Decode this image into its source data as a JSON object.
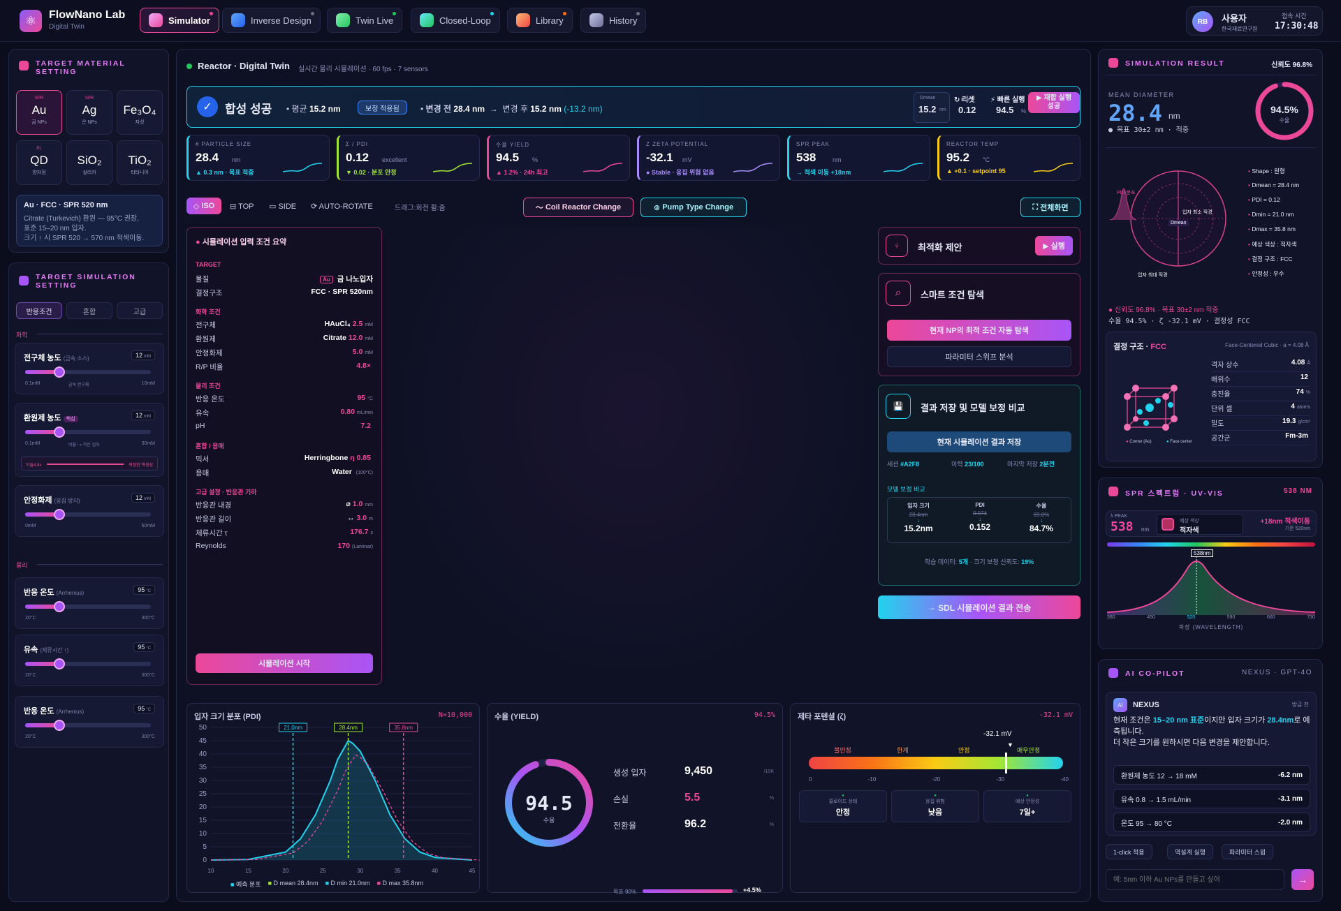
{
  "app": {
    "name": "FlowNano Lab",
    "subtitle": "Digital Twin"
  },
  "nav": [
    {
      "label": "Simulator",
      "color": "#ec4899"
    },
    {
      "label": "Inverse Design",
      "color": "#3b82f6"
    },
    {
      "label": "Twin Live",
      "color": "#22c55e"
    },
    {
      "label": "Closed-Loop",
      "color": "#22d3ee"
    },
    {
      "label": "Library",
      "color": "#f97316"
    },
    {
      "label": "History",
      "color": "#8b8fbf"
    }
  ],
  "user": {
    "initials": "RB",
    "name": "사용자",
    "org": "한국재료연구원",
    "time_label": "접속 시간",
    "time": "17:30:48"
  },
  "material": {
    "title": "TARGET MATERIAL SETTING",
    "items": [
      {
        "tag": "SPR",
        "sym": "Au",
        "name": "금 NPs"
      },
      {
        "tag": "SPR",
        "sym": "Ag",
        "name": "은 NPs"
      },
      {
        "tag": "",
        "sym": "Fe₃O₄",
        "name": "자성"
      },
      {
        "tag": "PL",
        "sym": "QD",
        "name": "양자점"
      },
      {
        "tag": "",
        "sym": "SiO₂",
        "name": "실리카"
      },
      {
        "tag": "",
        "sym": "TiO₂",
        "name": "티타니아"
      }
    ],
    "info_title": "Au · FCC · SPR 520 nm",
    "info_l1": "Citrate (Turkevich) 환원 — 95°C 권장,",
    "info_l2": "표준 15–20 nm 입자.",
    "info_l3": "크기 ↑ 시 SPR 520 → 570 nm 적색이동."
  },
  "simset": {
    "title": "TARGET SIMULATION SETTING",
    "tabs": [
      "반응조건",
      "혼합",
      "고급"
    ],
    "sec1": "화학",
    "sec2": "물리",
    "sliders": [
      {
        "label": "전구체 농도",
        "hint": "(금속 소스)",
        "val": "12",
        "unit": "mM",
        "min": "0.1mM",
        "mid": "금속 전구체",
        "max": "10mM",
        "frac": 0.27
      },
      {
        "label": "환원제 농도",
        "hint": "핵심",
        "val": "12",
        "unit": "mM",
        "min": "0.1mM",
        "mid": "비율↑ = 작은 입자",
        "max": "30mM",
        "frac": 0.27,
        "sub": "이들4.8x",
        "sub2": "적정한 핵생성"
      },
      {
        "label": "안정화제",
        "hint": "(응집 방지)",
        "val": "12",
        "unit": "mM",
        "min": "0mM",
        "mid": "",
        "max": "50mM",
        "frac": 0.27
      },
      {
        "label": "반응 온도",
        "hint": "(Arrhenius)",
        "val": "95",
        "unit": "°C",
        "min": "20°C",
        "mid": "",
        "max": "300°C",
        "frac": 0.27
      },
      {
        "label": "유속",
        "hint": "(체류시간 ↑)",
        "val": "95",
        "unit": "°C",
        "min": "20°C",
        "mid": "",
        "max": "300°C",
        "frac": 0.27
      },
      {
        "label": "반응 온도",
        "hint": "(Arrhenius)",
        "val": "95",
        "unit": "°C",
        "min": "20°C",
        "mid": "",
        "max": "300°C",
        "frac": 0.27
      }
    ]
  },
  "reactor": {
    "title": "Reactor · Digital Twin",
    "sub": "실시간 물리 시뮬레이션 · 60 fps · 7 sensors"
  },
  "banner": {
    "status": "합성 성공",
    "avg_label": "평균",
    "avg": "15.2 nm",
    "badge": "보정 적용됨",
    "before_label": "변경 전",
    "before": "28.4 nm",
    "after_label": "변경 후",
    "after": "15.2 nm",
    "delta": "(-13.2 nm)",
    "dmean_label": "Dmean",
    "dmean": "15.2",
    "dmean_unit": "nm",
    "reset": "리셋",
    "pdi_label": "PDI",
    "pdi": "0.12",
    "fast": "빠른 실행",
    "fast_val": "94.5",
    "fast_unit": "%",
    "rerun": "▶ 재합 실행",
    "rerun2": "성공"
  },
  "metrics": [
    {
      "label": "# PARTICLE SIZE",
      "val": "28.4",
      "unit": "nm",
      "delta": "▲ 0.3 nm · 목표 적중",
      "color": "#22d3ee"
    },
    {
      "label": "Σ / PDI",
      "val": "0.12",
      "unit": "excellent",
      "delta": "▼ 0.02 · 분포 안정",
      "color": "#a3e635"
    },
    {
      "label": "수율 YIELD",
      "val": "94.5",
      "unit": "%",
      "delta": "▲ 1.2% · 24h 최고",
      "color": "#ec4899"
    },
    {
      "label": "Ζ ZETA POTENTIAL",
      "val": "-32.1",
      "unit": "mV",
      "delta": "● Stable · 응집 위험 없음",
      "color": "#a78bfa"
    },
    {
      "label": "SPR PEAK",
      "val": "538",
      "unit": "nm",
      "delta": "→ 적색 이동 +18nm",
      "color": "#22d3ee"
    },
    {
      "label": "REACTOR TEMP",
      "val": "95.2",
      "unit": "°C",
      "delta": "▲ +0.1 · setpoint 95",
      "color": "#facc15"
    }
  ],
  "view": {
    "iso": "ISO",
    "top": "TOP",
    "side": "SIDE",
    "auto": "AUTO-ROTATE",
    "hint": "드래그:회전 휠:줌",
    "coil": "Coil Reactor Change",
    "pump": "Pump Type Change",
    "full": "전체화면"
  },
  "summary": {
    "title": "시뮬레이션 입력 조건 요약",
    "target_h": "TARGET",
    "rows1": [
      [
        "물질",
        "Au",
        "금 나노입자"
      ],
      [
        "결정구조",
        "",
        "FCC · SPR 520nm"
      ]
    ],
    "chem_h": "화학 조건",
    "chem": [
      [
        "전구체",
        "HAuCl₄",
        "2.5",
        "mM"
      ],
      [
        "환원제",
        "Citrate",
        "12.0",
        "mM"
      ],
      [
        "안정화제",
        "",
        "5.0",
        "mM"
      ],
      [
        "R/P 비율",
        "",
        "4.8×",
        ""
      ]
    ],
    "phys_h": "물리 조건",
    "phys": [
      [
        "반응 온도",
        "",
        "95",
        "°C"
      ],
      [
        "유속",
        "",
        "0.80",
        "mL/min"
      ],
      [
        "pH",
        "",
        "7.2",
        ""
      ]
    ],
    "mix_h": "혼합 / 용매",
    "mix": [
      [
        "믹서",
        "Herringbone",
        "η 0.85",
        ""
      ],
      [
        "용매",
        "Water",
        "",
        "(100°C)"
      ]
    ],
    "adv_h": "고급 설정 · 반응관 기하",
    "adv": [
      [
        "반응관 내경",
        "⌀",
        "1.0",
        "mm"
      ],
      [
        "반응관 길이",
        "↔",
        "3.0",
        "m"
      ],
      [
        "체류시간 τ",
        "",
        "176.7",
        "s"
      ],
      [
        "Reynolds",
        "",
        "170",
        "(Laminar)"
      ]
    ],
    "start": "시뮬레이션 시작"
  },
  "opt": {
    "title": "최적화 제안",
    "run": "▶ 실행",
    "smart": "스마트 조건 탐색",
    "smart_btn": "현재 NP의 최적 조건 자동 탐색",
    "sweep": "파라미터 스위프 분석",
    "save_title": "결과 저장 및 모델 보정 비교",
    "save_btn": "현재 시뮬레이션 결과 저장",
    "session_l": "세션",
    "session": "#A2F8",
    "hist_l": "이력",
    "hist": "23/100",
    "last_l": "마지막 저장",
    "last": "2분전",
    "cmp_h": "모델 보정 비교",
    "cmp": [
      {
        "h": "입자 크기",
        "old": "28.4nm",
        "new": "15.2nm"
      },
      {
        "h": "PDI",
        "old": "0.074",
        "new": "0.152"
      },
      {
        "h": "수율",
        "old": "69.0%",
        "new": "84.7%"
      }
    ],
    "foot_l": "학습 데이터:",
    "foot_n": "5개",
    "foot_m": "· 크기 보정 신뢰도:",
    "foot_p": "19%",
    "send": "SDL 시뮬레이션 결과 전송"
  },
  "pdi_chart": {
    "title": "입자 크기 분포 (PDI)",
    "n": "N=10,000",
    "markers": [
      "21.0nm",
      "28.4nm",
      "35.8nm"
    ],
    "legend": [
      "예측 분포",
      "D mean 28.4nm",
      "D min 21.0nm",
      "D max 35.8nm"
    ]
  },
  "chart_data": {
    "type": "area",
    "x": [
      10,
      15,
      20,
      22,
      24,
      26,
      27,
      28,
      28.4,
      29,
      30,
      32,
      34,
      36,
      38,
      40,
      45
    ],
    "series": [
      {
        "name": "예측 분포",
        "values": [
          0,
          0.2,
          3,
          8,
          17,
          30,
          38,
          43,
          45,
          44,
          41,
          30,
          17,
          8,
          3,
          1,
          0
        ]
      }
    ],
    "xlim": [
      10,
      45
    ],
    "ylim": [
      0,
      50
    ],
    "yticks": [
      0,
      5,
      10,
      15,
      20,
      25,
      30,
      35,
      40,
      45,
      50
    ],
    "xticks": [
      10,
      15,
      20,
      25,
      30,
      35,
      40,
      45
    ],
    "vlines": [
      21,
      28.4,
      35.8
    ]
  },
  "yield": {
    "title": "수율 (YIELD)",
    "pct": "94.5%",
    "big": "94.5",
    "big_l": "수율",
    "rows": [
      [
        "생성 입자",
        "9,450",
        "/10K"
      ],
      [
        "손실",
        "5.5",
        "%"
      ],
      [
        "전환율",
        "96.2",
        "%"
      ]
    ],
    "goal": "목표 90%",
    "goal_d": "+4.5%",
    "fraction": 0.945
  },
  "zeta": {
    "title": "제타 포텐셜 (ζ)",
    "val": "-32.1 mV",
    "marker": "-32.1 mV",
    "bands": [
      "불안정",
      "한계",
      "안정",
      "매우안정"
    ],
    "ticks": [
      "0",
      "-10",
      "-20",
      "-30",
      "-40"
    ],
    "boxes": [
      [
        "콜로이드 상태",
        "안정"
      ],
      [
        "응집 위험",
        "낮음"
      ],
      [
        "예상 안정성",
        "7일+"
      ]
    ]
  },
  "result": {
    "title": "SIMULATION RESULT",
    "conf": "신뢰도 96.8%",
    "md_label": "MEAN DIAMETER",
    "md": "28.4",
    "md_unit": "nm",
    "goal": "목표 30±2 nm · 적중",
    "ring": "94.5%",
    "ring_l": "수율",
    "legend": [
      "Shape : 원형",
      "Dmean = 28.4 nm",
      "PDI = 0.12",
      "Dmin = 21.0 nm",
      "Dmax = 35.8 nm",
      "예상 색상 : 적자색",
      "결정 구조 : FCC",
      "안정성 : 우수"
    ],
    "pdi_tag": "PDI 분포",
    "c_min": "입자 최소 직경",
    "c_mean": "Dmean",
    "c_max": "입자 최대 직경",
    "foot1": "신뢰도 96.8% · 목표 30±2 nm 적중",
    "foot2": "수율 94.5% · ζ -32.1 mV · 결정성 FCC",
    "crystal_t": "결정 구조 ·",
    "crystal_v": "FCC",
    "crystal_d": "Face-Centered Cubic · a = 4.08 Å",
    "crystal_rows": [
      [
        "격자 상수",
        "4.08",
        "Å"
      ],
      [
        "배위수",
        "12",
        ""
      ],
      [
        "충진율",
        "74",
        "%"
      ],
      [
        "단위 셀",
        "4",
        "atoms"
      ],
      [
        "밀도",
        "19.3",
        "g/cm³"
      ],
      [
        "공간군",
        "Fm-3m",
        ""
      ]
    ],
    "crystal_leg": [
      "Corner (Au)",
      "Face center"
    ]
  },
  "spr": {
    "title": "SPR 스펙트럼 · UV-VIS",
    "peak": "538 NM",
    "peak_l": "λ PEAK",
    "peak_v": "538",
    "peak_u": "nm",
    "color_l": "예상 색상",
    "color_v": "적자색",
    "shift": "+18nm 적색이동",
    "base": "기준 520nm",
    "tag": "538nm",
    "ticks": [
      "380",
      "450",
      "520",
      "590",
      "660",
      "730"
    ],
    "xlabel": "파장 (WAVELENGTH)"
  },
  "copilot": {
    "title": "AI CO-PILOT",
    "model": "NEXUS · GPT-4O",
    "bot": "NEXUS",
    "time": "방금 전",
    "msg1": "현재 조건은 ",
    "msg_hl": "15–20 nm 표준",
    "msg2": "이지만 입자 크기가 ",
    "msg_hl2": "28.4nm",
    "msg3": "로 예측됩니다.",
    "msg4": "더 작은 크기를 원하시면 다음 변경을 제안합니다.",
    "sugs": [
      [
        "환원제 농도 12 → 18 mM",
        "-6.2 nm"
      ],
      [
        "유속 0.8 → 1.5 mL/min",
        "-3.1 nm"
      ],
      [
        "온도 95 → 80 °C",
        "-2.0 nm"
      ]
    ],
    "chips": [
      "1-click 적용",
      "역설계 실행",
      "파라미터 스윕"
    ],
    "placeholder": "예: 5nm 이하 Au NPs를 만들고 싶어"
  }
}
